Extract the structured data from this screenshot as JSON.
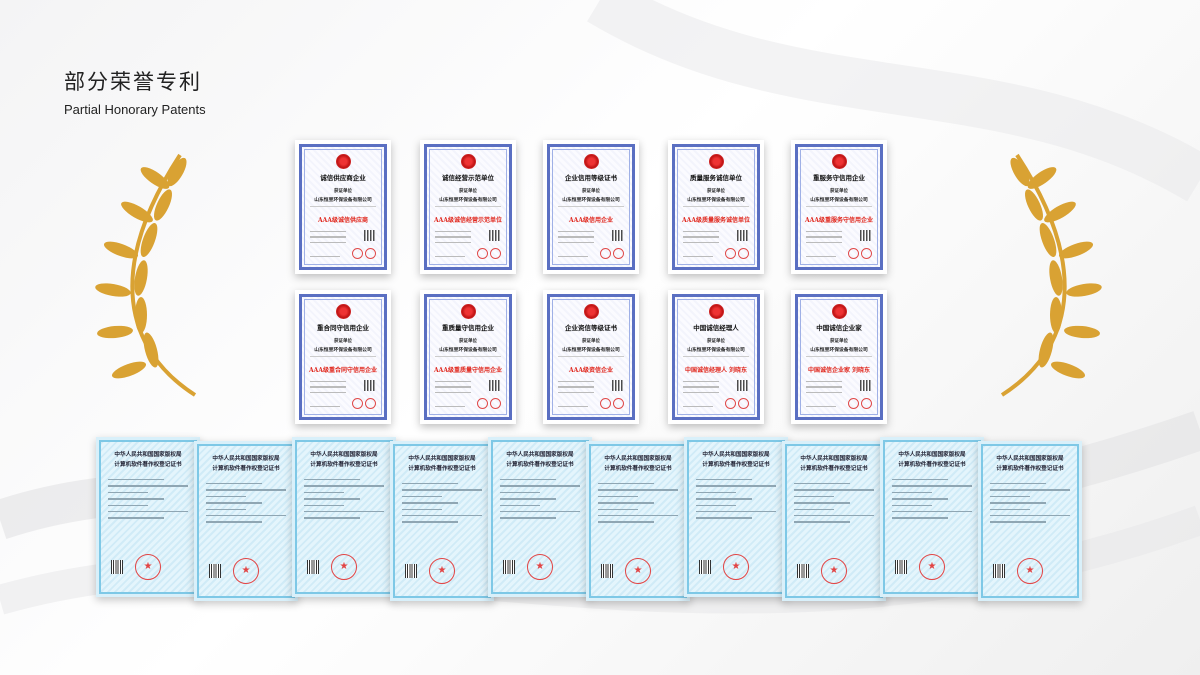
{
  "header": {
    "title_zh": "部分荣誉专利",
    "title_en": "Partial Honorary Patents"
  },
  "colors": {
    "laurel_gold": "#d9a233",
    "cert_border": "#5a6fc2",
    "level_red": "#e0261c",
    "soft_bg": "#d9f0fa"
  },
  "honor_certificates": [
    {
      "title": "诚信供应商企业",
      "label": "获证单位",
      "company": "山东恒昱环保设备有限公司",
      "level": "AAA级诚信供应商"
    },
    {
      "title": "诚信经营示范单位",
      "label": "获证单位",
      "company": "山东恒昱环保设备有限公司",
      "level": "AAA级诚信经营示范单位"
    },
    {
      "title": "企业信用等级证书",
      "label": "获证单位",
      "company": "山东恒昱环保设备有限公司",
      "level": "AAA级信用企业"
    },
    {
      "title": "质量服务诚信单位",
      "label": "获证单位",
      "company": "山东恒昱环保设备有限公司",
      "level": "AAA级质量服务诚信单位"
    },
    {
      "title": "重服务守信用企业",
      "label": "获证单位",
      "company": "山东恒昱环保设备有限公司",
      "level": "AAA级重服务守信用企业"
    },
    {
      "title": "重合同守信用企业",
      "label": "获证单位",
      "company": "山东恒昱环保设备有限公司",
      "level": "AAA级重合同守信用企业"
    },
    {
      "title": "重质量守信用企业",
      "label": "获证单位",
      "company": "山东恒昱环保设备有限公司",
      "level": "AAA级重质量守信用企业"
    },
    {
      "title": "企业资信等级证书",
      "label": "获证单位",
      "company": "山东恒昱环保设备有限公司",
      "level": "AAA级资信企业"
    },
    {
      "title": "中国诚信经理人",
      "label": "获证单位",
      "company": "山东恒昱环保设备有限公司",
      "level": "中国诚信经理人  刘晓东"
    },
    {
      "title": "中国诚信企业家",
      "label": "获证单位",
      "company": "山东恒昱环保设备有限公司",
      "level": "中国诚信企业家  刘晓东"
    }
  ],
  "software_certificates": {
    "head_line1": "中华人民共和国国家版权局",
    "head_line2": "计算机软件著作权登记证书"
  }
}
